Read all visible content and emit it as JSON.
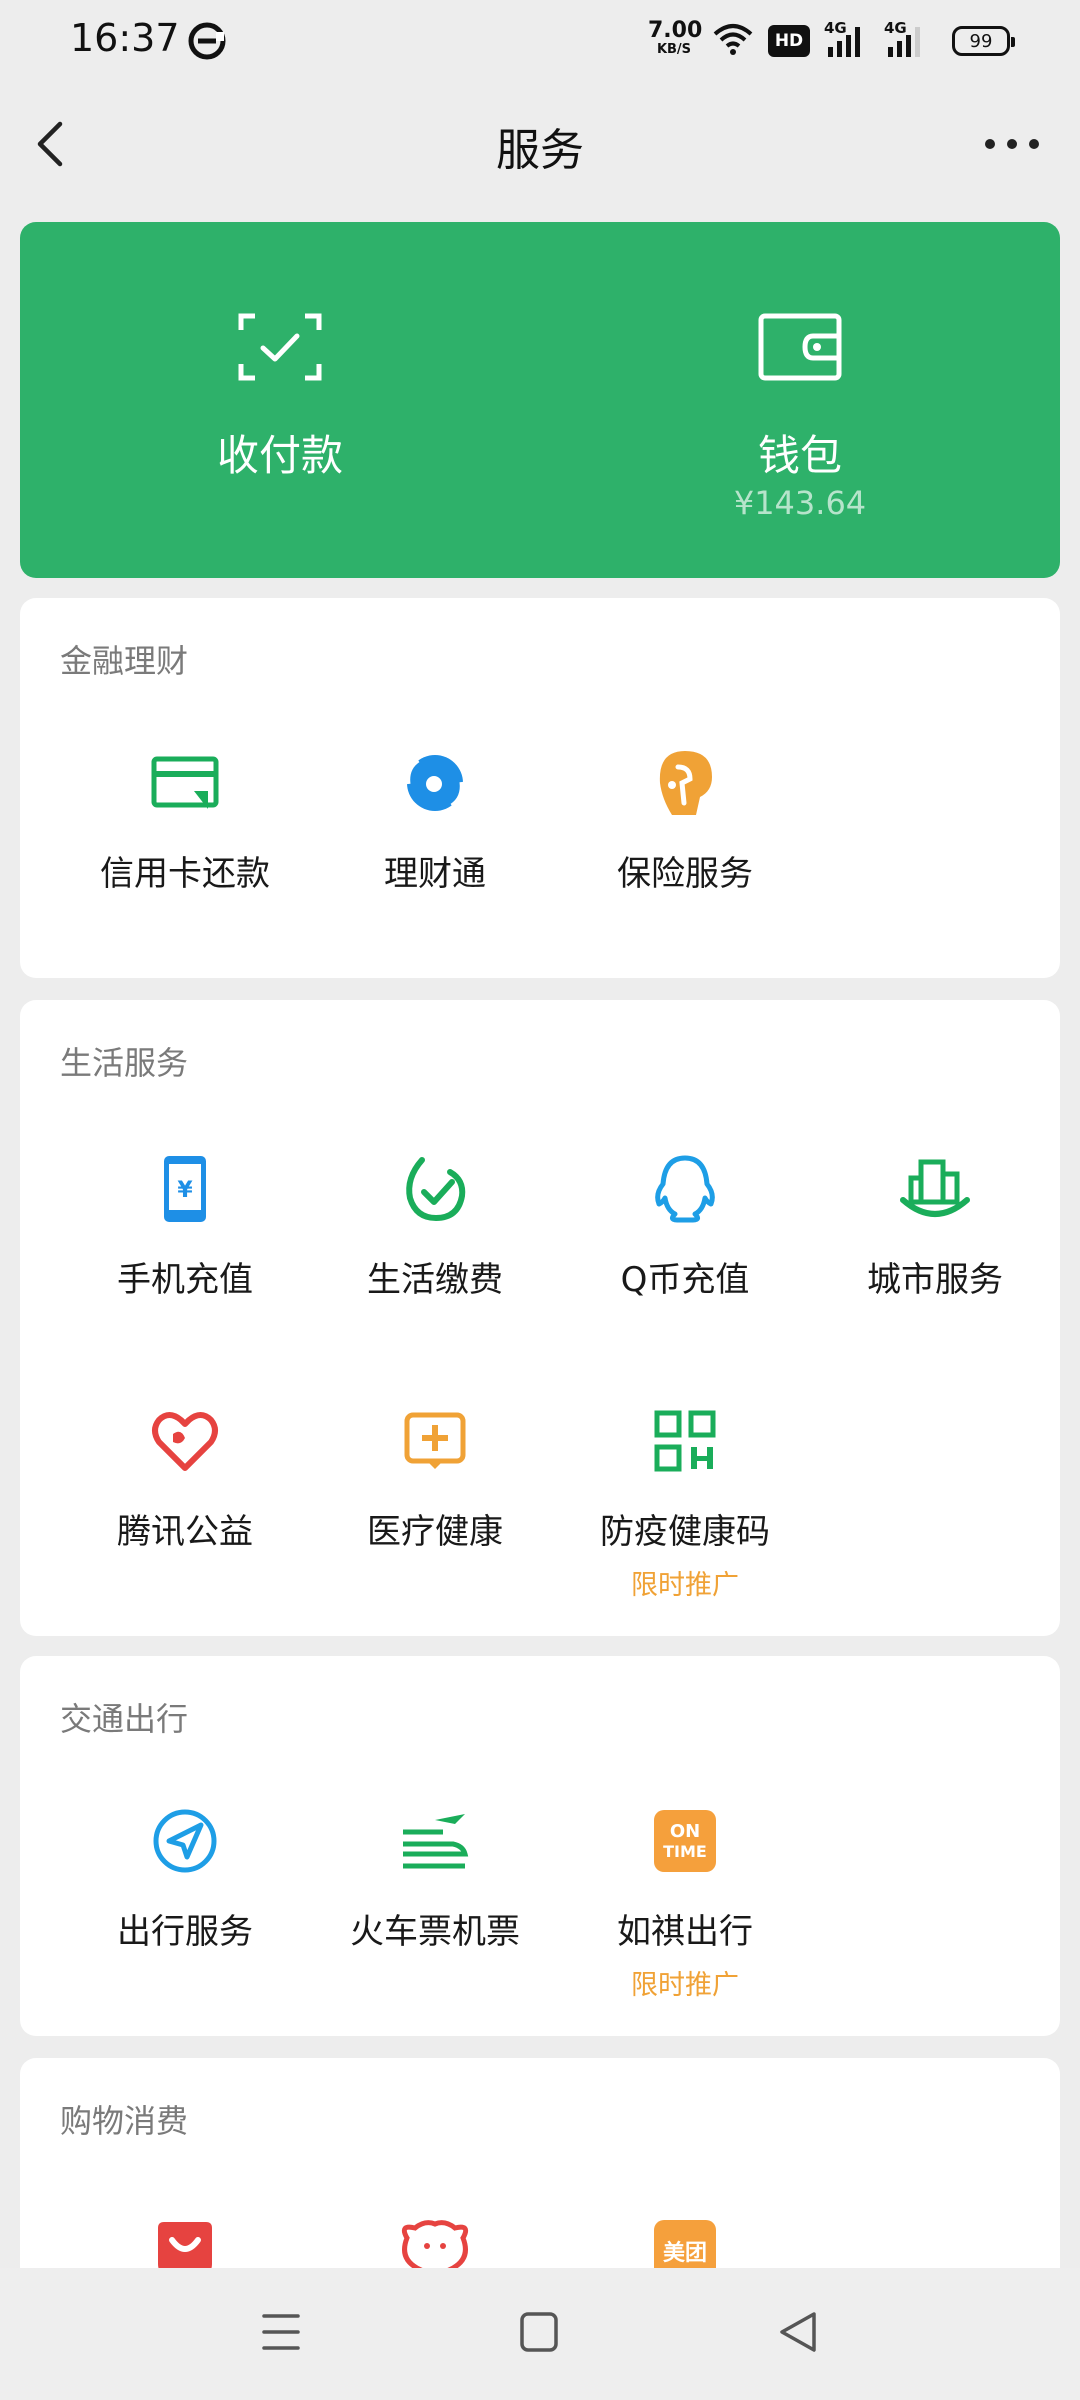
{
  "status_bar": {
    "time": "16:37",
    "net_speed_value": "7.00",
    "net_speed_unit": "KB/S",
    "hd_label": "HD",
    "signal_label_1": "4G",
    "signal_label_2": "4G",
    "battery": "99"
  },
  "nav": {
    "title": "服务"
  },
  "pay_card": {
    "pay_label": "收付款",
    "wallet_label": "钱包",
    "wallet_balance": "¥143.64",
    "background_color": "#2eb16a"
  },
  "sections": {
    "finance": {
      "title": "金融理财",
      "items": [
        {
          "label": "信用卡还款",
          "icon": "credit-card-icon"
        },
        {
          "label": "理财通",
          "icon": "wealth-icon"
        },
        {
          "label": "保险服务",
          "icon": "insurance-icon"
        }
      ]
    },
    "life": {
      "title": "生活服务",
      "items": [
        {
          "label": "手机充值",
          "icon": "phone-topup-icon"
        },
        {
          "label": "生活缴费",
          "icon": "utility-payment-icon"
        },
        {
          "label": "Q币充值",
          "icon": "qq-coin-icon"
        },
        {
          "label": "城市服务",
          "icon": "city-services-icon"
        },
        {
          "label": "腾讯公益",
          "icon": "charity-heart-icon"
        },
        {
          "label": "医疗健康",
          "icon": "medical-icon"
        },
        {
          "label": "防疫健康码",
          "icon": "qr-code-icon",
          "promo": "限时推广"
        }
      ]
    },
    "transport": {
      "title": "交通出行",
      "items": [
        {
          "label": "出行服务",
          "icon": "navigation-icon"
        },
        {
          "label": "火车票机票",
          "icon": "train-plane-icon"
        },
        {
          "label": "如祺出行",
          "icon": "ontime-icon",
          "promo": "限时推广",
          "icon_text_1": "ON",
          "icon_text_2": "TIME"
        }
      ]
    },
    "shopping": {
      "title": "购物消费",
      "items": [
        {
          "icon": "shopping-bag-icon"
        },
        {
          "icon": "pinduoduo-icon"
        },
        {
          "icon": "meituan-icon",
          "icon_text": "美团"
        }
      ]
    }
  },
  "colors": {
    "green": "#2eb16a",
    "blue": "#1e8fe6",
    "orange": "#f0a236",
    "red": "#e64340"
  }
}
